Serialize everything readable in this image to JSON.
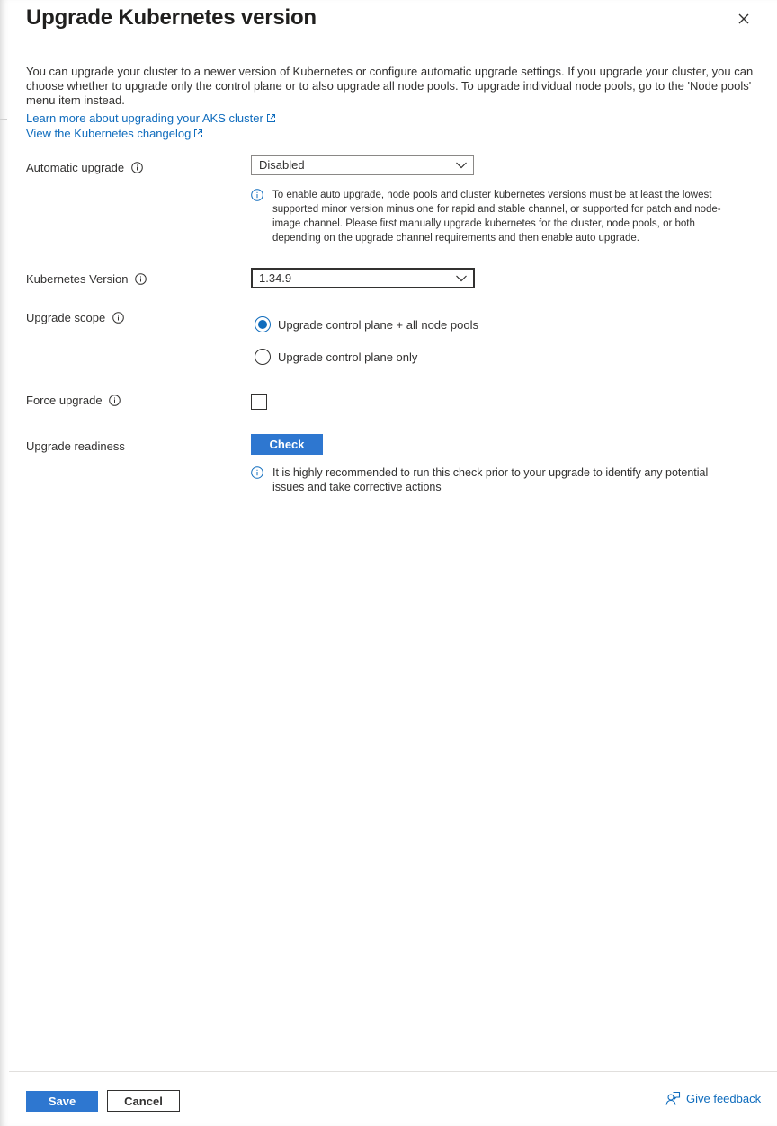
{
  "header": {
    "title": "Upgrade Kubernetes version"
  },
  "description": "You can upgrade your cluster to a newer version of Kubernetes or configure automatic upgrade settings. If you upgrade your cluster, you can choose whether to upgrade only the control plane or to also upgrade all node pools. To upgrade individual node pools, go to the 'Node pools' menu item instead.",
  "links": {
    "learn_more": "Learn more about upgrading your AKS cluster",
    "changelog": "View the Kubernetes changelog"
  },
  "automatic_upgrade": {
    "label": "Automatic upgrade",
    "value": "Disabled",
    "note_lines": [
      "To enable auto upgrade, node pools and cluster kubernetes versions must be at least the lowest",
      "supported minor version minus one for rapid and stable channel, or supported for patch and node-",
      "image channel. Please first manually upgrade kubernetes for the cluster, node pools, or both",
      "depending on the upgrade channel requirements and then enable auto upgrade."
    ]
  },
  "kubernetes_version": {
    "label": "Kubernetes Version",
    "value": "1.34.9"
  },
  "upgrade_scope": {
    "label": "Upgrade scope",
    "options": [
      {
        "label": "Upgrade control plane + all node pools",
        "checked": true
      },
      {
        "label": "Upgrade control plane only",
        "checked": false
      }
    ]
  },
  "force_upgrade": {
    "label": "Force upgrade",
    "checked": false
  },
  "upgrade_readiness": {
    "label": "Upgrade readiness",
    "button": "Check",
    "note_lines": [
      "It is highly recommended to run this check prior to your upgrade to identify any potential",
      "issues and take corrective actions"
    ]
  },
  "footer": {
    "save": "Save",
    "cancel": "Cancel",
    "feedback": "Give feedback"
  },
  "colors": {
    "primary": "#2e77d0",
    "link": "#0f6cbd",
    "text": "#323130"
  }
}
